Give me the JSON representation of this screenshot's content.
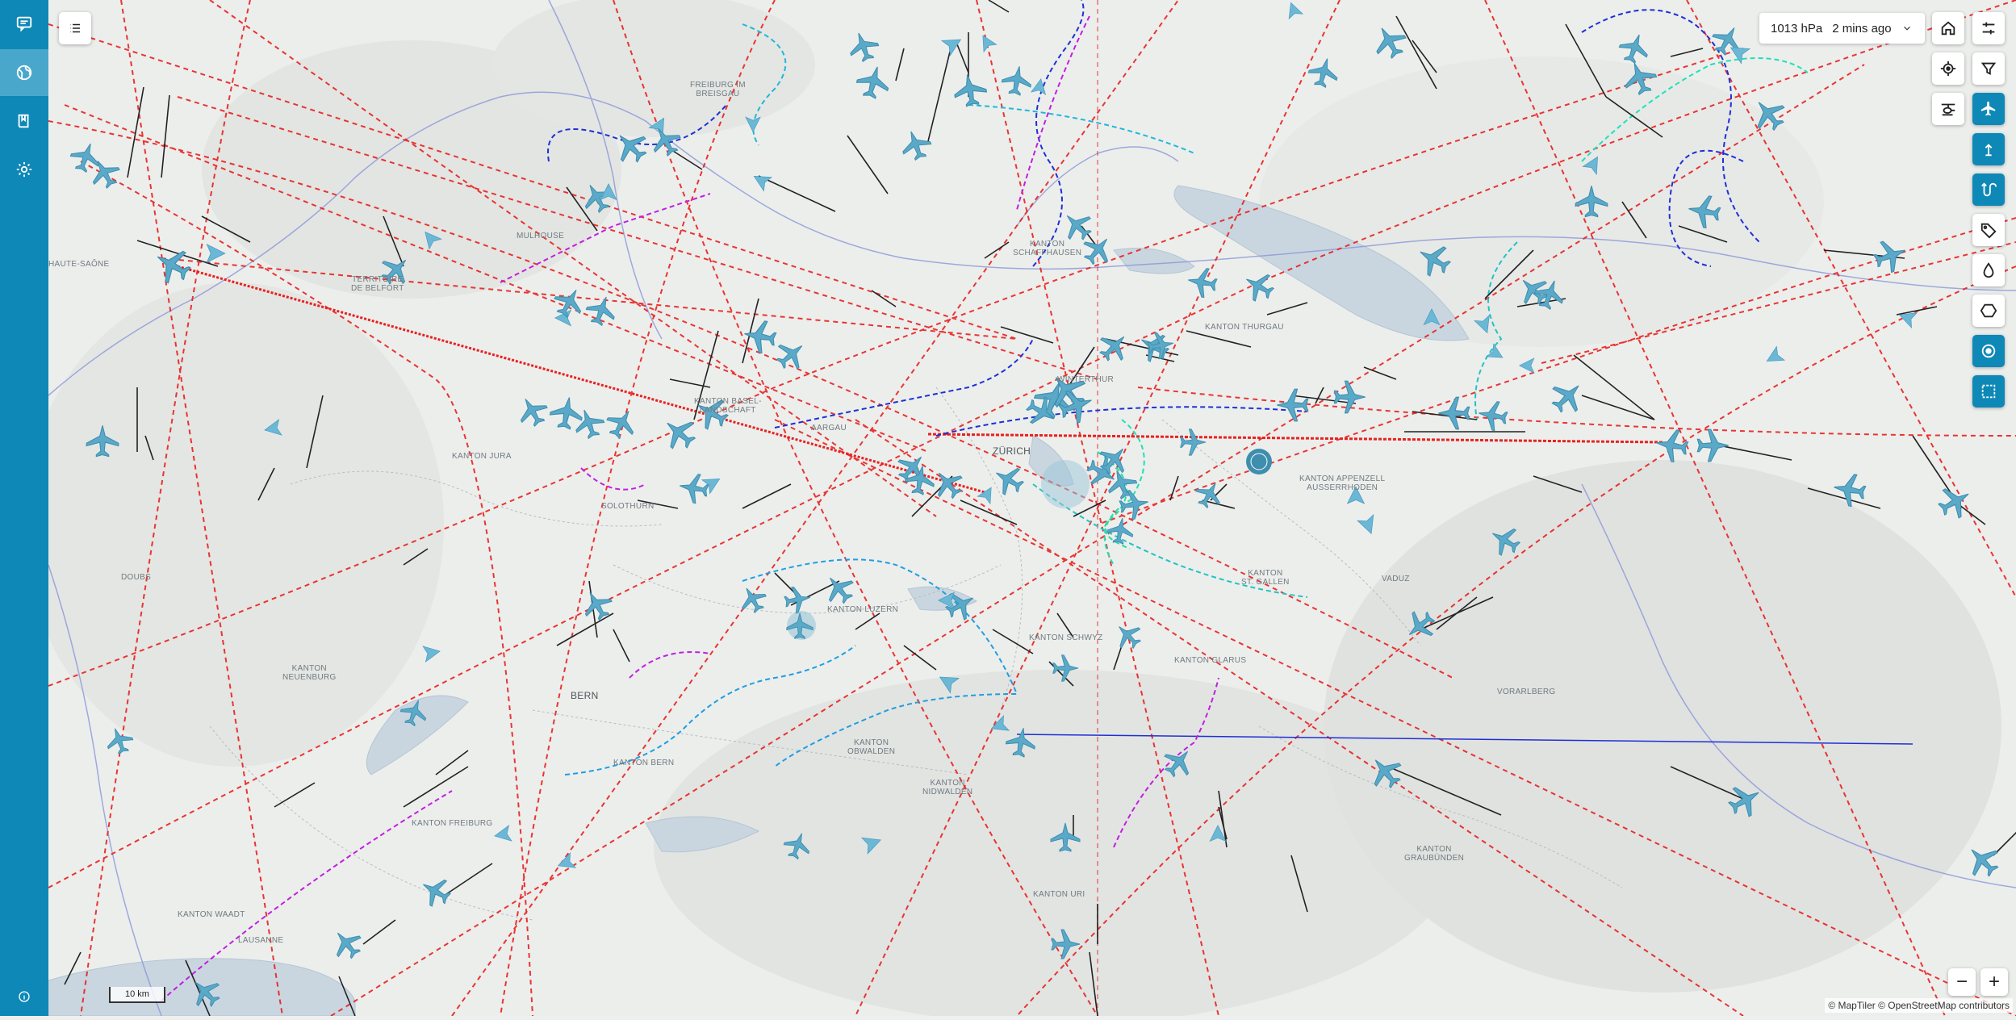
{
  "sidebar": {
    "items": [
      {
        "name": "messages",
        "icon": "chat-icon",
        "active": false
      },
      {
        "name": "map",
        "icon": "globe-icon",
        "active": true
      },
      {
        "name": "bookmarks",
        "icon": "book-icon",
        "active": false
      },
      {
        "name": "settings",
        "icon": "gear-icon",
        "active": false
      }
    ],
    "info_icon": "info-icon"
  },
  "header": {
    "pressure": "1013 hPa",
    "updated": "2 mins ago"
  },
  "map": {
    "places": [
      {
        "id": "freiburg",
        "label": "FREIBURG IM\nBREISGAU",
        "city": false
      },
      {
        "id": "schaffhausen",
        "label": "KANTON\nSCHAFFHAUSEN",
        "city": false
      },
      {
        "id": "territoire",
        "label": "TERRITOIRE\nDE BELFORT",
        "city": false
      },
      {
        "id": "haute-saone",
        "label": "HAUTE-SAÔNE",
        "city": false
      },
      {
        "id": "mulhouse",
        "label": "MULHOUSE",
        "city": false
      },
      {
        "id": "thurgau",
        "label": "KANTON THURGAU",
        "city": false
      },
      {
        "id": "winterthur",
        "label": "WINTERTHUR",
        "city": false
      },
      {
        "id": "basel",
        "label": "KANTON BASEL-\nLANDSCHAFT",
        "city": false
      },
      {
        "id": "aargau",
        "label": "AARGAU",
        "city": false
      },
      {
        "id": "zurich",
        "label": "ZÜRICH",
        "city": true
      },
      {
        "id": "jura",
        "label": "KANTON JURA",
        "city": false
      },
      {
        "id": "solothurn",
        "label": "SOLOTHURN",
        "city": false
      },
      {
        "id": "appenzell",
        "label": "KANTON APPENZELL\nAUSSERRHODEN",
        "city": false
      },
      {
        "id": "stgallen",
        "label": "KANTON\nST. GALLEN",
        "city": false
      },
      {
        "id": "luzern",
        "label": "KANTON LUZERN",
        "city": false
      },
      {
        "id": "schwyz",
        "label": "KANTON SCHWYZ",
        "city": false
      },
      {
        "id": "glarus",
        "label": "KANTON GLARUS",
        "city": false
      },
      {
        "id": "vaduz",
        "label": "VADUZ",
        "city": false
      },
      {
        "id": "vorarlberg",
        "label": "VORARLBERG",
        "city": false
      },
      {
        "id": "doubs",
        "label": "DOUBS",
        "city": false
      },
      {
        "id": "neuenburg",
        "label": "KANTON\nNEUENBURG",
        "city": false
      },
      {
        "id": "bern",
        "label": "BERN",
        "city": true
      },
      {
        "id": "kanton-bern",
        "label": "KANTON BERN",
        "city": false
      },
      {
        "id": "obwalden",
        "label": "KANTON\nOBWALDEN",
        "city": false
      },
      {
        "id": "nidwalden",
        "label": "KANTON\nNIDWALDEN",
        "city": false
      },
      {
        "id": "freiburg-ch",
        "label": "KANTON FREIBURG",
        "city": false
      },
      {
        "id": "graubunden",
        "label": "KANTON\nGRAUBÜNDEN",
        "city": false
      },
      {
        "id": "uri",
        "label": "KANTON URI",
        "city": false
      },
      {
        "id": "waadt",
        "label": "KANTON WAADT",
        "city": false
      },
      {
        "id": "lausanne",
        "label": "LAUSANNE",
        "city": false
      }
    ],
    "scale": "10 km",
    "attribution": "© MapTiler © OpenStreetMap contributors"
  },
  "controls": {
    "left": [
      {
        "name": "list",
        "icon": "list-icon"
      }
    ],
    "right_top": [
      {
        "name": "home",
        "icon": "home-icon",
        "active": false
      },
      {
        "name": "settings-sliders",
        "icon": "sliders-icon",
        "active": false
      },
      {
        "name": "locate",
        "icon": "crosshair-icon",
        "active": false
      },
      {
        "name": "filter",
        "icon": "filter-icon",
        "active": false
      },
      {
        "name": "heli-layer",
        "icon": "helicopter-icon",
        "active": false
      }
    ],
    "right_column": [
      {
        "name": "aircraft-layer",
        "icon": "airplane-icon",
        "active": true
      },
      {
        "name": "altitude-layer",
        "icon": "altitude-icon",
        "active": true
      },
      {
        "name": "tracks-layer",
        "icon": "route-icon",
        "active": true
      },
      {
        "name": "labels-layer",
        "icon": "tag-icon",
        "active": false
      },
      {
        "name": "weather-layer",
        "icon": "drop-icon",
        "active": false
      },
      {
        "name": "airspace-layer",
        "icon": "hexagon-icon",
        "active": false
      },
      {
        "name": "range-layer",
        "icon": "circle-target-icon",
        "active": true
      },
      {
        "name": "area-select",
        "icon": "selection-icon",
        "active": true
      }
    ],
    "zoom_out": "−",
    "zoom_in": "+"
  },
  "colors": {
    "sidebar": "#0e88b6",
    "active": "#4aa7cc",
    "plane": "#5aa9c8",
    "route_red": "#e8211f",
    "track_blue": "#1f2fd6",
    "track_cyan": "#1fc4c4",
    "track_magenta": "#c21ee0",
    "lake": "#c9d6e0"
  }
}
